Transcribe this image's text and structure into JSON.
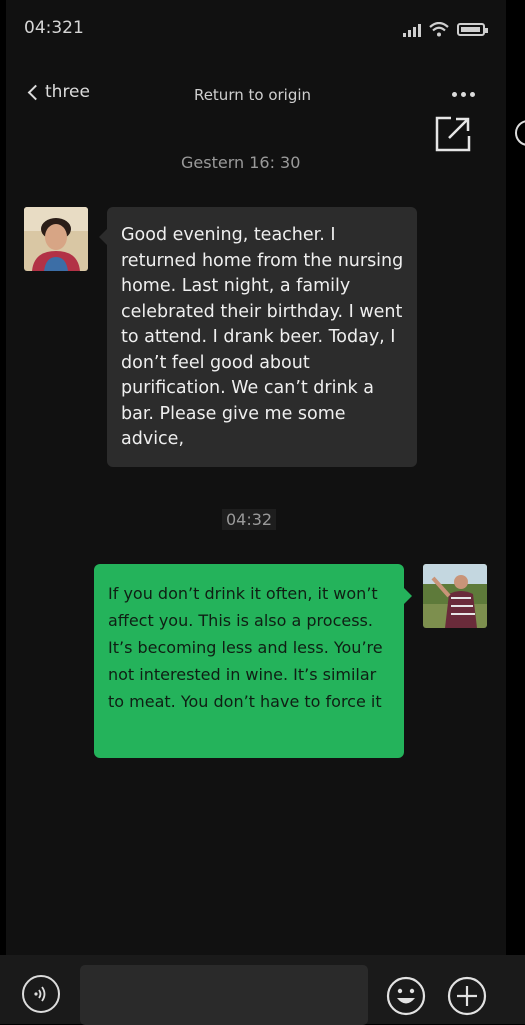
{
  "status_bar": {
    "time": "04:321"
  },
  "nav": {
    "back_label": "three",
    "title": "Return to origin"
  },
  "messages": [
    {
      "type": "timestamp",
      "text": "Gestern 16: 30"
    },
    {
      "type": "incoming",
      "text": "Good evening, teacher. I returned home from the nursing home. Last night, a family celebrated their birthday. I went to attend. I drank beer. Today, I don’t feel good about purification.  We can’t drink a bar. Please give me some advice,"
    },
    {
      "type": "timestamp",
      "text": "04:32"
    },
    {
      "type": "outgoing",
      "text": "If you don’t drink it often, it won’t affect you. This is also a process. It’s becoming less and less. You’re not interested in wine. It’s similar to meat. You don’t have to force it"
    }
  ],
  "icons": {
    "back": "chevron-left-icon",
    "more": "more-dots-icon",
    "share": "share-external-icon",
    "voice": "voice-icon",
    "emoji": "emoji-icon",
    "plus": "plus-icon"
  },
  "colors": {
    "background": "#111111",
    "incoming_bubble": "#2c2c2c",
    "outgoing_bubble": "#24b35b"
  }
}
